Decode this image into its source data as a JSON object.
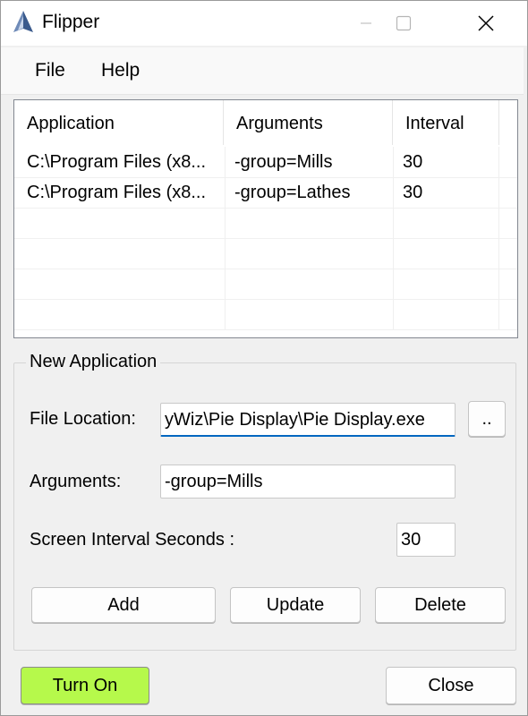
{
  "window": {
    "title": "Flipper"
  },
  "menu": {
    "file": "File",
    "help": "Help"
  },
  "list": {
    "columns": [
      "Application",
      "Arguments",
      "Interval"
    ],
    "rows": [
      [
        "C:\\Program Files (x8...",
        "-group=Mills",
        "30"
      ],
      [
        "C:\\Program Files (x8...",
        "-group=Lathes",
        "30"
      ]
    ]
  },
  "new_app": {
    "group_title": "New Application",
    "file_location_label": "File Location:",
    "file_location_value": "yWiz\\Pie Display\\Pie Display.exe",
    "browse_label": "..",
    "arguments_label": "Arguments:",
    "arguments_value": "-group=Mills",
    "interval_label": "Screen Interval Seconds :",
    "interval_value": "30",
    "add_label": "Add",
    "update_label": "Update",
    "delete_label": "Delete"
  },
  "footer": {
    "turn_on_label": "Turn On",
    "close_label": "Close"
  },
  "colors": {
    "turn_on_bg": "#b6f94b",
    "focus_underline": "#0067c0"
  },
  "icons": {
    "app": "flipper-app-icon",
    "minimize": "minimize-icon",
    "maximize": "maximize-icon",
    "close": "close-icon"
  }
}
